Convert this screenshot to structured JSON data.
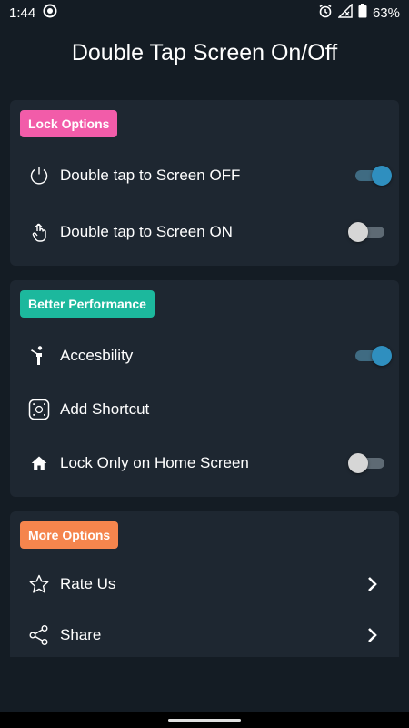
{
  "status_bar": {
    "time": "1:44",
    "battery": "63%",
    "icons": [
      "record-icon",
      "alarm-icon",
      "signal-icon",
      "battery-icon"
    ]
  },
  "app": {
    "title": "Double Tap Screen On/Off"
  },
  "sections": {
    "lock": {
      "badge": "Lock Options",
      "badge_color": "#f25ca9",
      "items": [
        {
          "label": "Double tap to Screen OFF",
          "icon": "power-icon",
          "toggle": true
        },
        {
          "label": "Double tap to Screen ON",
          "icon": "tap-hand-icon",
          "toggle": false
        }
      ]
    },
    "performance": {
      "badge": "Better Performance",
      "badge_color": "#1cb89d",
      "items": [
        {
          "label": "Accesbility",
          "icon": "accessibility-icon",
          "toggle": true
        },
        {
          "label": "Add Shortcut",
          "icon": "shortcut-icon"
        },
        {
          "label": "Lock Only on Home Screen",
          "icon": "home-icon",
          "toggle": false
        }
      ]
    },
    "more": {
      "badge": "More Options",
      "badge_color": "#f5854d",
      "items": [
        {
          "label": "Rate Us",
          "icon": "star-icon"
        },
        {
          "label": "Share",
          "icon": "share-icon"
        }
      ]
    }
  },
  "colors": {
    "background": "#141c24",
    "card": "#1e2731",
    "toggle_on": "#2f8fbf"
  }
}
